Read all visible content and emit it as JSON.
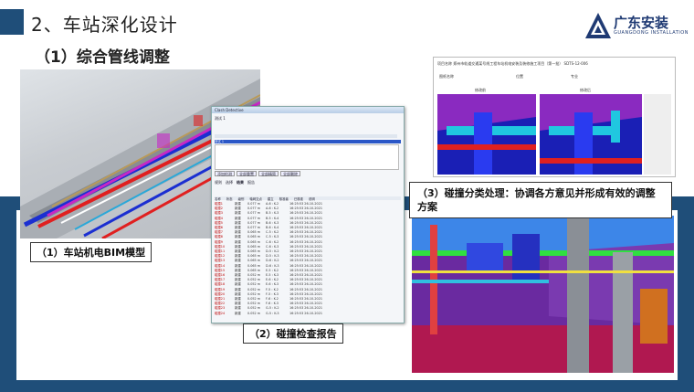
{
  "header": {
    "section_title": "2、车站深化设计",
    "subsection_title": "（1）综合管线调整"
  },
  "logo": {
    "name": "广东安装",
    "subname": "GUANGDONG INSTALLATION"
  },
  "captions": {
    "bim_model": "（1）车站机电BIM模型",
    "clash_report": "（2）碰撞检查报告",
    "clash_handling": "（3）碰撞分类处理：协调各方意见并形成有效的调整方案"
  },
  "report_window": {
    "title": "Clash Detective",
    "test_name": "测试 1",
    "selected_test": "测试 1",
    "buttons": [
      "添加检测",
      "全部重置",
      "全部精简",
      "全部删除"
    ],
    "tabs": [
      "规则",
      "选择",
      "结果",
      "报告"
    ],
    "columns": [
      "名称",
      "状态",
      "级别",
      "轴网交点",
      "建立",
      "核准者",
      "已核准",
      "说明"
    ],
    "rows": [
      [
        "碰撞1",
        "新建",
        "0.077 m",
        "A-6 : K-2",
        "16:25:53 26-10-2021"
      ],
      [
        "碰撞2",
        "新建",
        "0.077 m",
        "A-6 : K-2",
        "16:25:53 26-10-2021"
      ],
      [
        "碰撞3",
        "新建",
        "0.077 m",
        "B-5 : K-3",
        "16:25:53 26-10-2021"
      ],
      [
        "碰撞4",
        "新建",
        "0.077 m",
        "B-5 : K-4",
        "16:25:53 26-10-2021"
      ],
      [
        "碰撞5",
        "新建",
        "0.077 m",
        "B-6 : K-3",
        "16:25:53 26-10-2021"
      ],
      [
        "碰撞6",
        "新建",
        "0.077 m",
        "B-6 : K-4",
        "16:25:53 26-10-2021"
      ],
      [
        "碰撞7",
        "新建",
        "0.065 m",
        "C-5 : K-2",
        "16:25:53 26-10-2021"
      ],
      [
        "碰撞8",
        "新建",
        "0.065 m",
        "C-5 : K-3",
        "16:25:53 26-10-2021"
      ],
      [
        "碰撞9",
        "新建",
        "0.065 m",
        "C-6 : K-2",
        "16:25:53 26-10-2021"
      ],
      [
        "碰撞10",
        "新建",
        "0.065 m",
        "C-6 : K-3",
        "16:25:53 26-10-2021"
      ],
      [
        "碰撞11",
        "新建",
        "0.065 m",
        "D-5 : K-2",
        "16:25:53 26-10-2021"
      ],
      [
        "碰撞12",
        "新建",
        "0.065 m",
        "D-5 : K-3",
        "16:25:53 26-10-2021"
      ],
      [
        "碰撞13",
        "新建",
        "0.065 m",
        "D-6 : K-2",
        "16:25:53 26-10-2021"
      ],
      [
        "碰撞14",
        "新建",
        "0.065 m",
        "D-6 : K-3",
        "16:25:53 26-10-2021"
      ],
      [
        "碰撞15",
        "新建",
        "0.065 m",
        "E-5 : K-2",
        "16:25:53 26-10-2021"
      ],
      [
        "碰撞16",
        "新建",
        "0.052 m",
        "E-5 : K-3",
        "16:25:53 26-10-2021"
      ],
      [
        "碰撞17",
        "新建",
        "0.052 m",
        "E-6 : K-2",
        "16:25:53 26-10-2021"
      ],
      [
        "碰撞18",
        "新建",
        "0.052 m",
        "E-6 : K-3",
        "16:25:53 26-10-2021"
      ],
      [
        "碰撞19",
        "新建",
        "0.052 m",
        "F-5 : K-2",
        "16:25:53 26-10-2021"
      ],
      [
        "碰撞20",
        "新建",
        "0.052 m",
        "F-5 : K-3",
        "16:25:53 26-10-2021"
      ],
      [
        "碰撞21",
        "新建",
        "0.052 m",
        "F-6 : K-2",
        "16:25:53 26-10-2021"
      ],
      [
        "碰撞22",
        "新建",
        "0.052 m",
        "F-6 : K-3",
        "16:25:53 26-10-2021"
      ],
      [
        "碰撞23",
        "新建",
        "0.052 m",
        "G-5 : K-2",
        "16:25:53 26-10-2021"
      ],
      [
        "碰撞24",
        "新建",
        "0.052 m",
        "G-5 : K-3",
        "16:25:53 26-10-2021"
      ]
    ]
  },
  "clash_doc": {
    "header_line": "项目名称   郑州市轨道交通某号线工程车站机电安装及装修施工项目（第一批）  SDTS-12-006",
    "row_labels": [
      "图纸名称",
      "位置",
      "专业"
    ],
    "before_label": "修改前",
    "after_label": "修改后"
  },
  "colors": {
    "brand_blue": "#1f4e79",
    "logo_blue": "#1f3a73"
  }
}
